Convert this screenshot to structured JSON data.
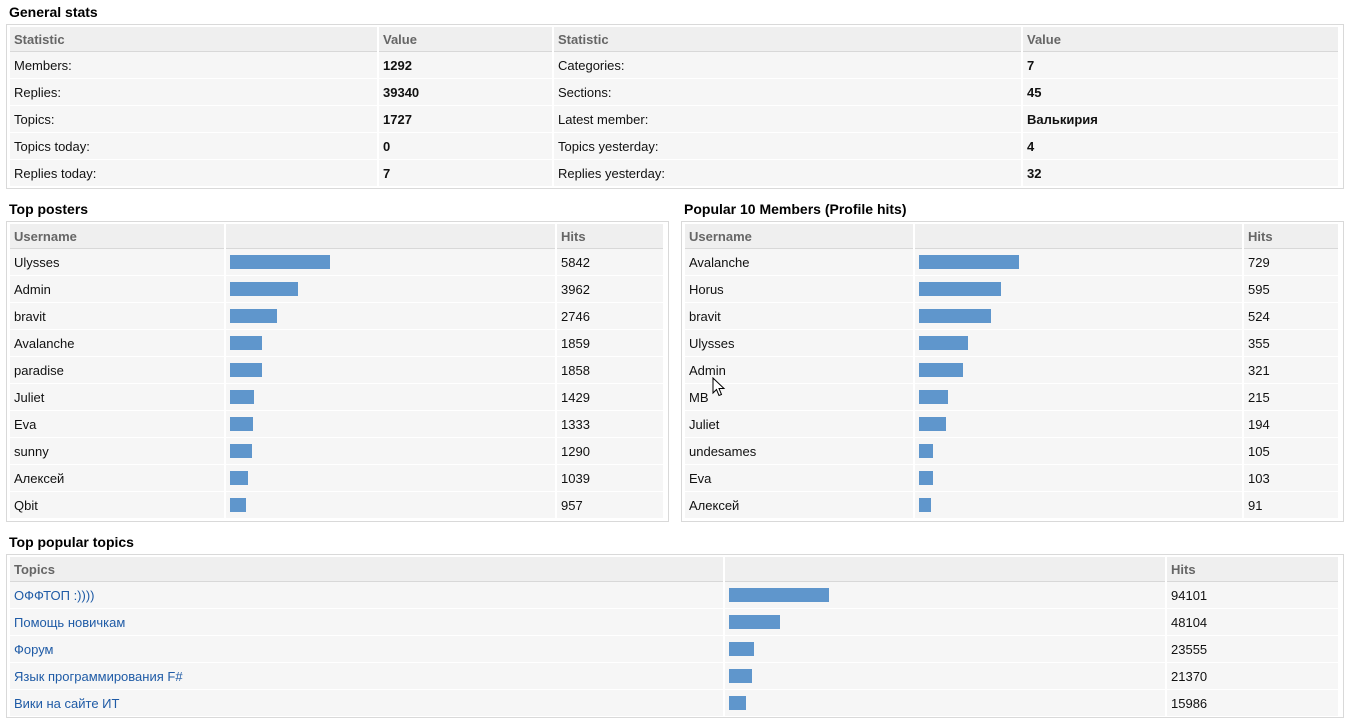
{
  "general": {
    "title": "General stats",
    "headers": [
      "Statistic",
      "Value",
      "Statistic",
      "Value"
    ],
    "rows": [
      [
        "Members:",
        "1292",
        "Categories:",
        "7"
      ],
      [
        "Replies:",
        "39340",
        "Sections:",
        "45"
      ],
      [
        "Topics:",
        "1727",
        "Latest member:",
        "Валькирия"
      ],
      [
        "Topics today:",
        "0",
        "Topics yesterday:",
        "4"
      ],
      [
        "Replies today:",
        "7",
        "Replies yesterday:",
        "32"
      ]
    ]
  },
  "top_posters": {
    "title": "Top posters",
    "headers": [
      "Username",
      "",
      "Hits"
    ],
    "rows": [
      {
        "name": "Ulysses",
        "hits": 5842
      },
      {
        "name": "Admin",
        "hits": 3962
      },
      {
        "name": "bravit",
        "hits": 2746
      },
      {
        "name": "Avalanche",
        "hits": 1859
      },
      {
        "name": "paradise",
        "hits": 1858
      },
      {
        "name": "Juliet",
        "hits": 1429
      },
      {
        "name": "Eva",
        "hits": 1333
      },
      {
        "name": "sunny",
        "hits": 1290
      },
      {
        "name": "Алексей",
        "hits": 1039
      },
      {
        "name": "Qbit",
        "hits": 957
      }
    ]
  },
  "popular_members": {
    "title": "Popular 10 Members (Profile hits)",
    "headers": [
      "Username",
      "",
      "Hits"
    ],
    "rows": [
      {
        "name": "Avalanche",
        "hits": 729
      },
      {
        "name": "Horus",
        "hits": 595
      },
      {
        "name": "bravit",
        "hits": 524
      },
      {
        "name": "Ulysses",
        "hits": 355
      },
      {
        "name": "Admin",
        "hits": 321
      },
      {
        "name": "MB",
        "hits": 215
      },
      {
        "name": "Juliet",
        "hits": 194
      },
      {
        "name": "undesames",
        "hits": 105
      },
      {
        "name": "Eva",
        "hits": 103
      },
      {
        "name": "Алексей",
        "hits": 91
      }
    ]
  },
  "popular_topics": {
    "title": "Top popular topics",
    "headers": [
      "Topics",
      "",
      "Hits"
    ],
    "rows": [
      {
        "name": "ОФФТОП :))))",
        "hits": 94101
      },
      {
        "name": "Помощь новичкам",
        "hits": 48104
      },
      {
        "name": "Форум",
        "hits": 23555
      },
      {
        "name": "Язык программирования F#",
        "hits": 21370
      },
      {
        "name": "Вики на сайте ИТ",
        "hits": 15986
      }
    ]
  },
  "colors": {
    "bar": "#5f96cc",
    "link": "#1f5ba6",
    "header_bg": "#efefef",
    "row_bg": "#f6f6f6"
  }
}
